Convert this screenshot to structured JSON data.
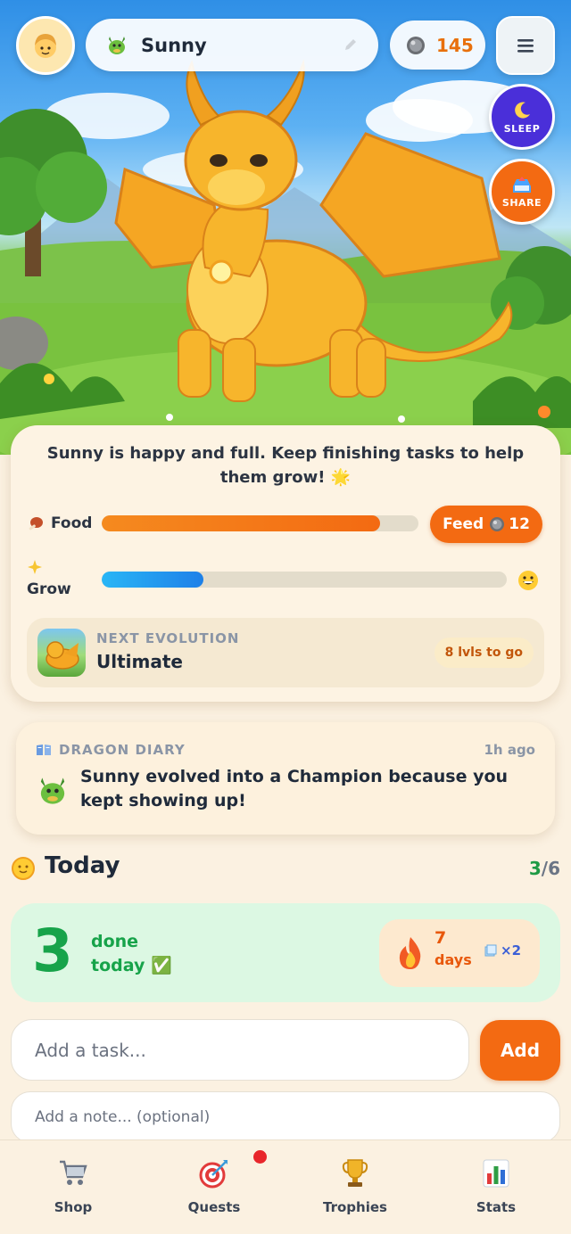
{
  "header": {
    "pet_name": "Sunny",
    "coins": "145",
    "sleep_label": "SLEEP",
    "share_label": "SHARE"
  },
  "status": {
    "message": "Sunny is happy and full. Keep finishing tasks to help them grow! 🌟",
    "food_label": "Food",
    "food_level": 0.88,
    "feed_button": "Feed",
    "feed_cost": "12",
    "grow_label": "Grow",
    "grow_level": 0.25,
    "mood_emoji": "😄"
  },
  "evolution": {
    "kicker": "NEXT EVOLUTION",
    "title": "Ultimate",
    "badge": "8 lvls to go"
  },
  "diary": {
    "kicker": "DRAGON DIARY",
    "time": "1h ago",
    "text": "Sunny evolved into a Champion because you kept showing up!"
  },
  "today": {
    "title": "Today",
    "done_count": "3",
    "total": "/6",
    "done_number": "3",
    "done_label_1": "done",
    "done_label_2": "today ✅",
    "streak_number": "7",
    "streak_unit": "days",
    "multiplier": "×2"
  },
  "inputs": {
    "task_placeholder": "Add a task...",
    "add_label": "Add",
    "note_placeholder": "Add a note... (optional)"
  },
  "nav": {
    "items": [
      {
        "label": "Shop",
        "icon": "cart-icon"
      },
      {
        "label": "Quests",
        "icon": "target-icon"
      },
      {
        "label": "Trophies",
        "icon": "trophy-icon"
      },
      {
        "label": "Stats",
        "icon": "bar-chart-icon"
      }
    ]
  },
  "colors": {
    "accent_orange": "#f36a12",
    "success_green": "#17a34a",
    "sleep_purple": "#4a2fd9",
    "grow_blue": "#2196f3"
  }
}
